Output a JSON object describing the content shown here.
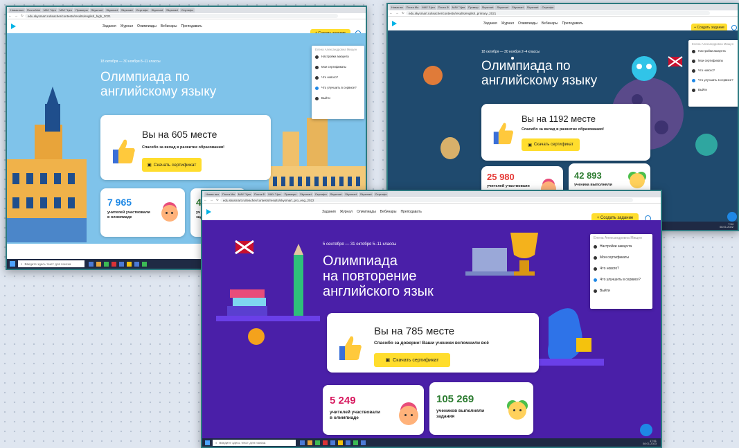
{
  "screens": {
    "one": {
      "tabs": [
        "Новая вкл",
        "Почта Mai",
        "МАУ \"Цен",
        "МАУ \"Цен",
        "Примеры",
        "Skysmart",
        "Skysmart",
        "Skysmart",
        "Сертифи",
        "Skysmart",
        "Skysmart",
        "Сертифи"
      ],
      "url": "edu.skysmart.ru/teacher/contests/results/english_high_2021",
      "nav": [
        "Задания",
        "Журнал",
        "Олимпиады",
        "Вебинары",
        "Преподавать"
      ],
      "create_button": "+ Создать задание",
      "menu": {
        "user": "Елена Александровна Мищен",
        "items": [
          "Настройки аккаунта",
          "Мои сертификаты",
          "Что нового?",
          "Что улучшить в сервисе?",
          "Выйти"
        ]
      },
      "date": "18 октября — 30 ноября   8–11 классы",
      "title": "Олимпиада по\nанглийскому языку",
      "place": "Вы на 605 месте",
      "thanks": "Спасибо за вклад в развитие образования!",
      "cert_button": "Скачать сертификат",
      "stat1_num": "7 965",
      "stat1_label": "учителей участвовали\nв олимпиаде",
      "stat2_num": "41",
      "stat2_label": "уч\nзад",
      "taskbar_search": "Введите здесь текст для поиска"
    },
    "two": {
      "tabs": [
        "Новая вк",
        "Почта Ma",
        "МАУ \"Цен",
        "Почта Ф",
        "МАУ \"Цен",
        "Пример",
        "Skysmart",
        "Skysmart",
        "Skysmart",
        "Skysmart",
        "Сертифи"
      ],
      "url": "edu.skysmart.ru/teacher/contests/results/english_primary_2021",
      "nav": [
        "Задания",
        "Журнал",
        "Олимпиады",
        "Вебинары",
        "Преподавать"
      ],
      "create_button": "+ Создать задание",
      "menu": {
        "user": "Елена Александровна Мищен",
        "items": [
          "Настройки аккаунта",
          "Мои сертификаты",
          "Что нового?",
          "Что улучшить в сервисе?",
          "Выйти"
        ]
      },
      "date": "18 октября — 30 ноября   2–4 классы",
      "title": "Олимпиада по\nанглийскому языку",
      "place": "Вы на 1192 месте",
      "thanks": "Спасибо за вклад в развитие образования!",
      "cert_button": "Скачать сертификат",
      "stat1_num": "25 980",
      "stat1_label": "учителей участвовали",
      "stat2_num": "42 893",
      "stat2_label": "ученика выполняли",
      "tray_time": "7:54",
      "tray_date": "08.01.2022"
    },
    "three": {
      "tabs": [
        "Новая вкл",
        "Почта Ма",
        "МАУ \"Цен",
        "Почта Ф",
        "МАУ \"Цен",
        "Примеры",
        "Skysmart",
        "Сертифи",
        "Skysmart",
        "Skysmart",
        "Skysmart",
        "Сертифи"
      ],
      "url": "edu.skysmart.ru/teacher/contests/results/skysmart_pro_eng_2022",
      "nav": [
        "Задания",
        "Журнал",
        "Олимпиады",
        "Вебинары",
        "Преподавать"
      ],
      "create_button": "+ Создать задание",
      "menu": {
        "user": "Елена Александровна Мищен",
        "items": [
          "Настройки аккаунта",
          "Мои сертификаты",
          "Что нового?",
          "Что улучшить в сервисе?",
          "Выйти"
        ]
      },
      "date": "5 сентября — 31 октября     5–11 классы",
      "title": "Олимпиада\nна повторение\nанглийского язык",
      "place": "Вы на 785 месте",
      "thanks": "Спасибо за доверие! Ваши ученики вспомнили всё",
      "cert_button": "Скачать сертификат",
      "stat1_num": "5 249",
      "stat1_label": "учителей участвовали\nв олимпиаде",
      "stat2_num": "105 269",
      "stat2_label": "учеников выполняли\nзадания",
      "taskbar_search": "Введите здесь текст для поиска",
      "tray_time": "17:51",
      "tray_date": "08.01.2023"
    }
  },
  "colors": {
    "accent_yellow": "#ffdd2d",
    "stat_blue": "#1e88e5",
    "stat_red": "#e53935",
    "stat_pink": "#d81b60",
    "stat_green": "#2e7d32",
    "hero_one": "#7fc3ea",
    "hero_two": "#1f4a6e",
    "hero_three": "#4a1fa8"
  }
}
